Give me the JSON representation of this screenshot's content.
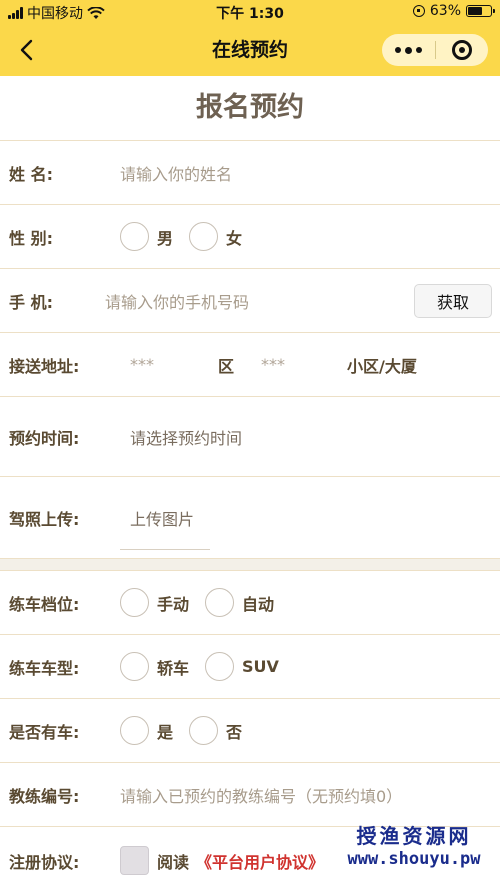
{
  "status_bar": {
    "carrier": "中国移动",
    "time": "下午 1:30",
    "battery": "63%",
    "battery_level": 0.63
  },
  "nav": {
    "title": "在线预约"
  },
  "form": {
    "heading": "报名预约",
    "name": {
      "label": "姓 名:",
      "placeholder": "请输入你的姓名"
    },
    "gender": {
      "label": "性 别:",
      "options": [
        "男",
        "女"
      ]
    },
    "phone": {
      "label": "手 机:",
      "placeholder": "请输入你的手机号码",
      "button": "获取"
    },
    "address": {
      "label": "接送地址:",
      "district_value": "***",
      "district_unit": "区",
      "community_value": "***",
      "community_unit": "小区/大厦"
    },
    "time": {
      "label": "预约时间:",
      "placeholder": "请选择预约时间"
    },
    "license": {
      "label": "驾照上传:",
      "button": "上传图片"
    },
    "gear": {
      "label": "练车档位:",
      "options": [
        "手动",
        "自动"
      ]
    },
    "car_type": {
      "label": "练车车型:",
      "options": [
        "轿车",
        "SUV"
      ]
    },
    "has_car": {
      "label": "是否有车:",
      "options": [
        "是",
        "否"
      ]
    },
    "coach": {
      "label": "教练编号:",
      "placeholder": "请输入已预约的教练编号（无预约填0）"
    },
    "agreement": {
      "label": "注册协议:",
      "read": "阅读",
      "link": "《平台用户协议》"
    }
  },
  "watermark": {
    "cn": "授渔资源网",
    "en": "www.shouyu.pw"
  }
}
